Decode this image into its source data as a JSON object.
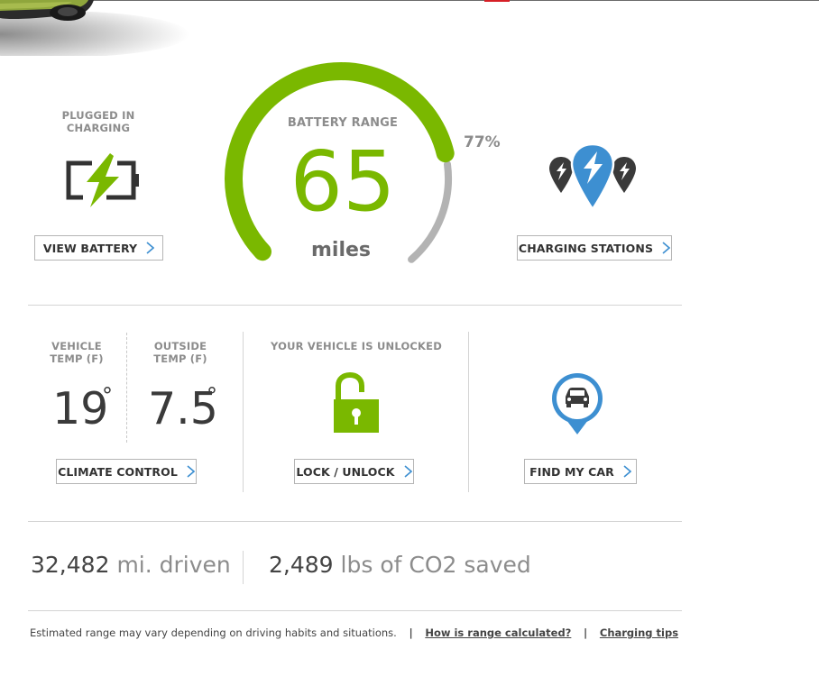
{
  "battery": {
    "status_line1": "PLUGGED IN",
    "status_line2": "CHARGING",
    "view_button": "VIEW BATTERY",
    "icon": "battery-charging-icon"
  },
  "range": {
    "label": "BATTERY RANGE",
    "value": "65",
    "unit": "miles",
    "percent_label": "77%",
    "percent": 77,
    "accent_color": "#7ab800",
    "remaining_color": "#b3b3b3"
  },
  "charging": {
    "button": "CHARGING STATIONS",
    "icon": "charging-stations-pins-icon"
  },
  "climate": {
    "vehicle_label_line1": "VEHICLE",
    "vehicle_label_line2": "TEMP (F)",
    "vehicle_temp": "19",
    "outside_label_line1": "OUTSIDE",
    "outside_label_line2": "TEMP (F)",
    "outside_temp": "7.5",
    "degree_symbol": "°",
    "button": "CLIMATE CONTROL"
  },
  "lock": {
    "status": "YOUR VEHICLE IS UNLOCKED",
    "button": "LOCK / UNLOCK",
    "icon": "unlocked-padlock-icon",
    "color": "#7ab800"
  },
  "find": {
    "button": "FIND MY CAR",
    "icon": "car-location-pin-icon",
    "color": "#3d8fd1"
  },
  "stats": {
    "miles_num": "32,482",
    "miles_unit": "mi. driven",
    "co2_num": "2,489",
    "co2_unit": "lbs of CO2 saved"
  },
  "footer": {
    "note": "Estimated range may vary depending on driving habits and situations.",
    "separator": "|",
    "link1": "How is range calculated?",
    "link2": "Charging tips"
  }
}
